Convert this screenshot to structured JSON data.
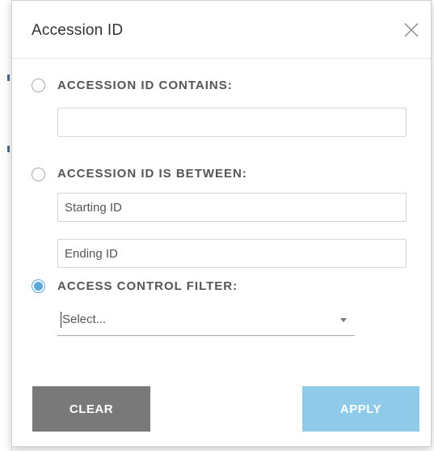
{
  "dialog": {
    "title": "Accession ID",
    "close_icon": "close-icon"
  },
  "options": [
    {
      "label": "ACCESSION ID CONTAINS:",
      "checked": false,
      "input": {
        "value": "",
        "placeholder": ""
      }
    },
    {
      "label": "ACCESSION ID IS BETWEEN:",
      "checked": false,
      "start": {
        "value": "",
        "placeholder": "Starting ID"
      },
      "end": {
        "value": "",
        "placeholder": "Ending ID"
      }
    },
    {
      "label": "ACCESS CONTROL FILTER:",
      "checked": true,
      "select": {
        "value": "Select..."
      }
    }
  ],
  "buttons": {
    "clear_label": "CLEAR",
    "apply_label": "APPLY"
  },
  "colors": {
    "accent": "#5aa8dc",
    "apply_bg": "#8fcbe9",
    "clear_bg": "#797979"
  }
}
